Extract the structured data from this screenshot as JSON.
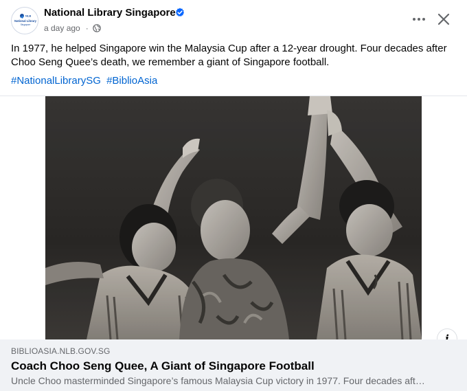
{
  "post": {
    "page_name": "National Library Singapore",
    "timestamp": "a day ago",
    "visibility_separator": "·",
    "text": "In 1977, he helped Singapore win the Malaysia Cup after a 12-year drought. Four decades after Choo Seng Quee’s death, we remember a giant of Singapore football.",
    "hashtags": [
      "#NationalLibrarySG",
      "#BiblioAsia"
    ],
    "verified": true
  },
  "avatar": {
    "logo_lines": [
      "NLB",
      "National Library",
      "Singapore"
    ]
  },
  "icons": {
    "verified": "verified-badge-icon",
    "globe": "globe-icon",
    "more": "more-options-icon",
    "close": "close-icon",
    "info": "info-icon"
  },
  "link": {
    "domain": "BIBLIOASIA.NLB.GOV.SG",
    "title": "Coach Choo Seng Quee, A Giant of Singapore Football",
    "description": "Uncle Choo masterminded Singapore’s famous Malaysia Cup victory in 1977. Four decades aft…",
    "info_label": "i"
  },
  "colors": {
    "link_blue": "#0064d1",
    "verified_blue": "#0866ff",
    "muted_gray": "#65676b",
    "card_bg": "#f0f2f5"
  }
}
